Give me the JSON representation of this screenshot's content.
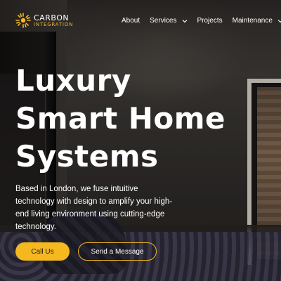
{
  "brand": {
    "line1": "CARBON",
    "line2": "INTEGRATION",
    "accent_color": "#f5b81f",
    "logo_icon": "sunburst-logo-icon"
  },
  "nav": {
    "items": [
      {
        "label": "About",
        "has_dropdown": false
      },
      {
        "label": "Services",
        "has_dropdown": true
      },
      {
        "label": "Projects",
        "has_dropdown": false
      },
      {
        "label": "Maintenance",
        "has_dropdown": true
      }
    ]
  },
  "hero": {
    "title_lines": [
      "Luxury",
      "Smart Home",
      "Systems"
    ],
    "description": "Based in London, we fuse intuitive technology with design to amplify your high-end living environment using cutting-edge technology.",
    "primary_button": "Call Us",
    "secondary_button": "Send a Message"
  }
}
